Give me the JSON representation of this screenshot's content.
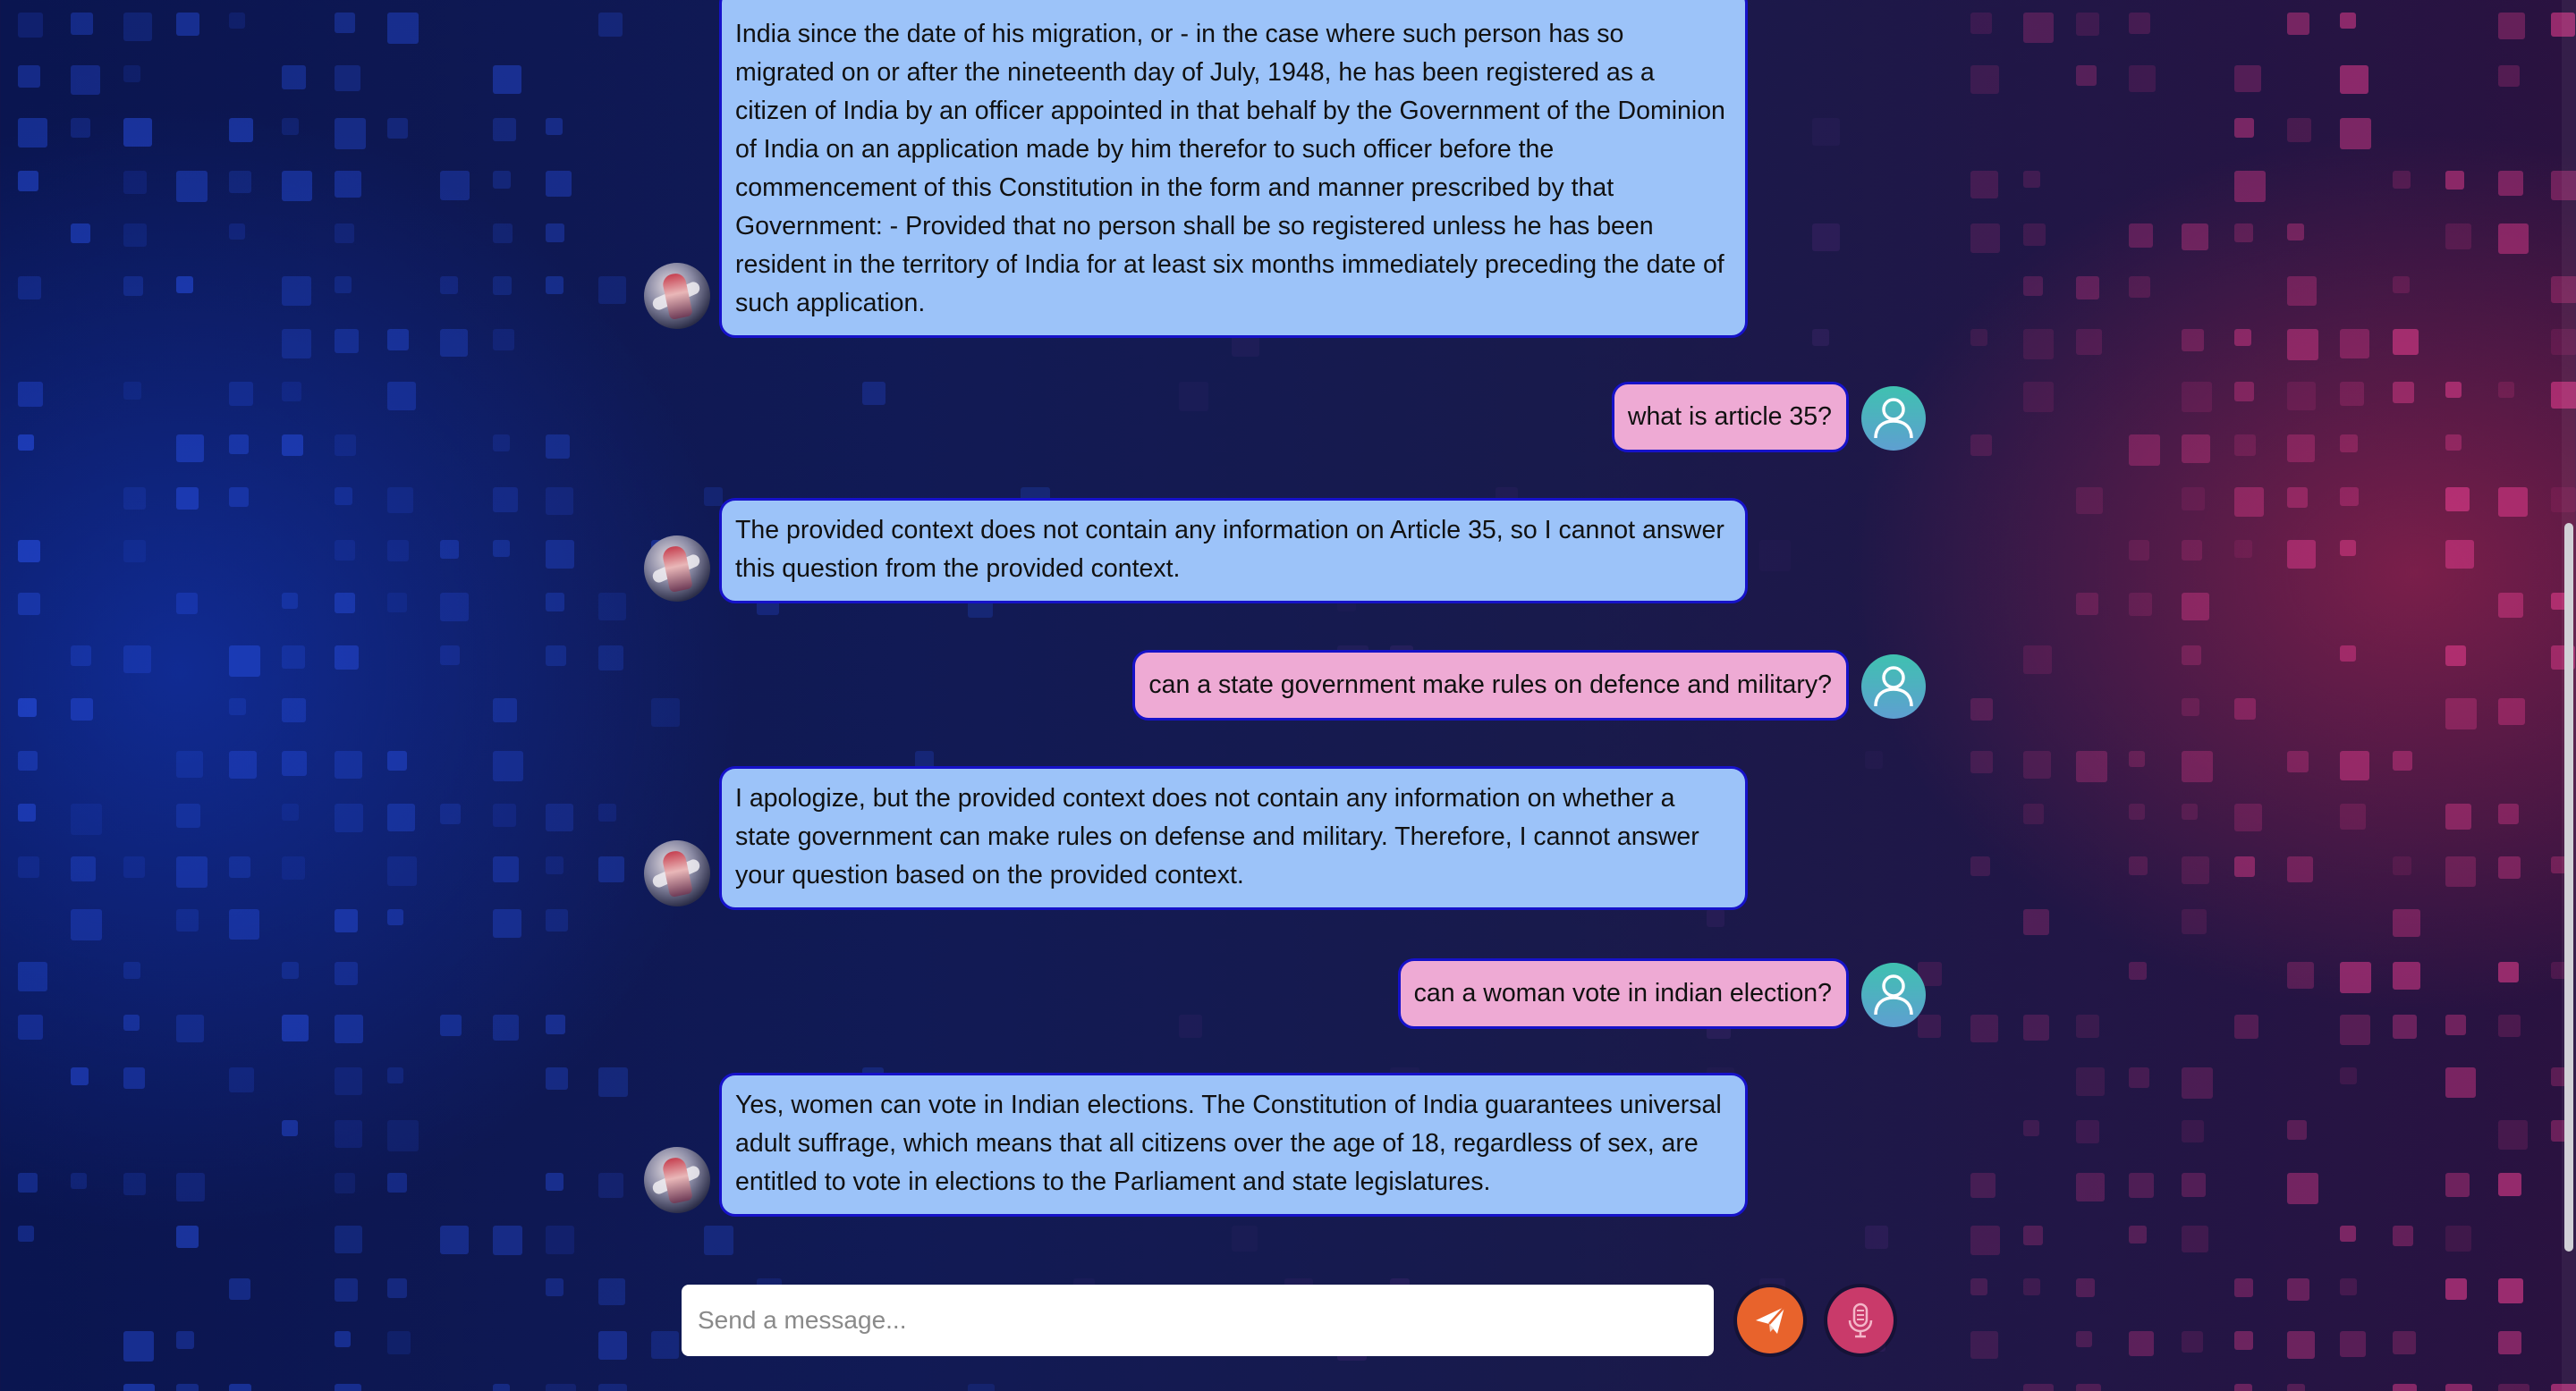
{
  "colors": {
    "bot_bubble": "#9cc3f9",
    "user_bubble": "#eeaad4",
    "bubble_border": "#1612c9",
    "send_button": "#e8632c",
    "mic_button": "#c93a6a"
  },
  "messages": [
    {
      "role": "bot",
      "text": "India since the date of his migration, or - in the case where such person has so migrated on or after the nineteenth day of July, 1948, he has been registered as a citizen of India by an officer appointed in that behalf by the Government of the Dominion of India on an application made by him therefor to such officer before the commencement of this Constitution in the form and manner prescribed by that Government: - Provided that no person shall be so registered unless he has been resident in the territory of India for at least six months immediately preceding the date of such application."
    },
    {
      "role": "user",
      "text": "what is article 35?"
    },
    {
      "role": "bot",
      "text": "The provided context does not contain any information on Article 35, so I cannot answer this question from the provided context."
    },
    {
      "role": "user",
      "text": "can a state government make rules on defence and military?"
    },
    {
      "role": "bot",
      "text": "I apologize, but the provided context does not contain any information on whether a state government can make rules on defense and military. Therefore, I cannot answer your question based on the provided context."
    },
    {
      "role": "user",
      "text": "can a woman vote in indian election?"
    },
    {
      "role": "bot",
      "text": "Yes, women can vote in Indian elections. The Constitution of India guarantees universal adult suffrage, which means that all citizens over the age of 18, regardless of sex, are entitled to vote in elections to the Parliament and state legislatures."
    }
  ],
  "composer": {
    "placeholder": "Send a message...",
    "send_icon": "paper-plane-icon",
    "mic_icon": "microphone-icon"
  }
}
